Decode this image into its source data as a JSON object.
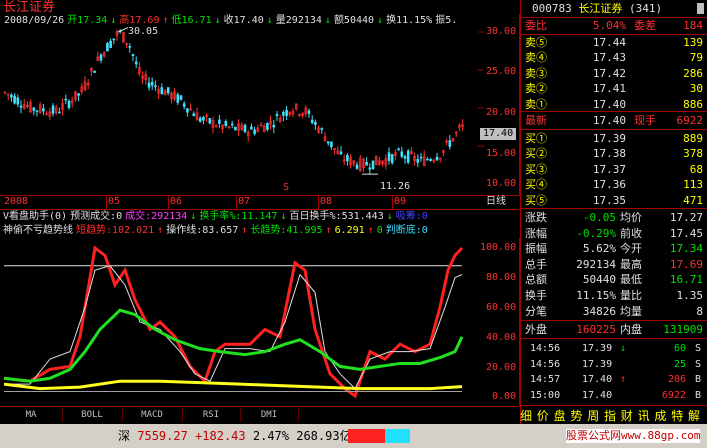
{
  "window": {
    "title": "长江证券",
    "menu_icon": "dropdown-arrow-icon"
  },
  "price_panel": {
    "info_line": [
      {
        "text": "2008/09/26",
        "color": "#e0e0e0"
      },
      {
        "text": "开17.34",
        "color": "#00e000"
      },
      {
        "text": "↓",
        "color": "#00e000"
      },
      {
        "text": "高17.69",
        "color": "#ff3030"
      },
      {
        "text": "↑",
        "color": "#ff3030"
      },
      {
        "text": "低16.71",
        "color": "#00e000"
      },
      {
        "text": "↓",
        "color": "#00e000"
      },
      {
        "text": "收17.40",
        "color": "#e0e0e0"
      },
      {
        "text": "↓",
        "color": "#00e000"
      },
      {
        "text": "量292134",
        "color": "#e0e0e0"
      },
      {
        "text": "↓",
        "color": "#00e000"
      },
      {
        "text": "额50440",
        "color": "#e0e0e0"
      },
      {
        "text": "↓",
        "color": "#00e000"
      },
      {
        "text": "换11.15%",
        "color": "#e0e0e0"
      },
      {
        "text": "振5.",
        "color": "#e0e0e0"
      }
    ],
    "y_axis": [
      "30.00",
      "25.00",
      "20.00",
      "15.00",
      "10.00"
    ],
    "high_label": "30.05",
    "low_label": "11.26",
    "current_price_marker": "17.40",
    "signal_mark": "S",
    "x_axis": [
      "2008",
      "05",
      "06",
      "07",
      "08",
      "09"
    ],
    "period_label": "日线"
  },
  "indicator_panel": {
    "line1": [
      {
        "text": "V看盘助手(0)",
        "color": "#e0e0e0"
      },
      {
        "text": "预测成交:0",
        "color": "#e0e0e0"
      },
      {
        "text": "成交:292134",
        "color": "#ff40ff"
      },
      {
        "text": "↓",
        "color": "#00e000"
      },
      {
        "text": "换手率%:11.147",
        "color": "#00e000"
      },
      {
        "text": "↓",
        "color": "#00e000"
      },
      {
        "text": "百日换手%:531.443",
        "color": "#e0e0e0"
      },
      {
        "text": "↓",
        "color": "#00e000"
      },
      {
        "text": "吸筹:0",
        "color": "#4040ff"
      }
    ],
    "line2": [
      {
        "text": "神偷不亏趋势线",
        "color": "#e0e0e0"
      },
      {
        "text": "短趋势:102.021",
        "color": "#ff3030"
      },
      {
        "text": "↑",
        "color": "#ff3030"
      },
      {
        "text": "操作线:83.657",
        "color": "#e0e0e0"
      },
      {
        "text": "↑",
        "color": "#ff3030"
      },
      {
        "text": "长趋势:41.995",
        "color": "#00e000"
      },
      {
        "text": "↑",
        "color": "#ff3030"
      },
      {
        "text": "6.291",
        "color": "#ffff00"
      },
      {
        "text": "↑",
        "color": "#ff3030"
      },
      {
        "text": "0",
        "color": "#00e000"
      },
      {
        "text": "判断底:0",
        "color": "#40e0ff"
      }
    ],
    "y_axis": [
      "100.00",
      "80.00",
      "60.00",
      "40.00",
      "20.00",
      "0.00"
    ],
    "tabs": [
      "MA",
      "BOLL",
      "MACD",
      "RSI",
      "DMI"
    ]
  },
  "quote": {
    "code": "000783",
    "name": "长江证券",
    "count": "(341)",
    "weibi_label": "委比",
    "weibi_value": "5.04%",
    "weicha_label": "委差",
    "weicha_value": "184",
    "asks": [
      {
        "label": "卖⑤",
        "price": "17.44",
        "vol": "139"
      },
      {
        "label": "卖④",
        "price": "17.43",
        "vol": "79"
      },
      {
        "label": "卖③",
        "price": "17.42",
        "vol": "286"
      },
      {
        "label": "卖②",
        "price": "17.41",
        "vol": "30"
      },
      {
        "label": "卖①",
        "price": "17.40",
        "vol": "886"
      }
    ],
    "latest_label": "最新",
    "latest_value": "17.40",
    "current_hand_label": "现手",
    "current_hand_value": "6922",
    "bids": [
      {
        "label": "买①",
        "price": "17.39",
        "vol": "889"
      },
      {
        "label": "买②",
        "price": "17.38",
        "vol": "378"
      },
      {
        "label": "买③",
        "price": "17.37",
        "vol": "68"
      },
      {
        "label": "买④",
        "price": "17.36",
        "vol": "113"
      },
      {
        "label": "买⑤",
        "price": "17.35",
        "vol": "471"
      }
    ],
    "stats": [
      {
        "l1": "涨跌",
        "v1": "-0.05",
        "c1": "#00e000",
        "l2": "均价",
        "v2": "17.27",
        "c2": "#e0e0e0"
      },
      {
        "l1": "涨幅",
        "v1": "-0.29%",
        "c1": "#00e000",
        "l2": "前收",
        "v2": "17.45",
        "c2": "#e0e0e0"
      },
      {
        "l1": "振幅",
        "v1": "5.62%",
        "c1": "#e0e0e0",
        "l2": "今开",
        "v2": "17.34",
        "c2": "#00e000"
      },
      {
        "l1": "总手",
        "v1": "292134",
        "c1": "#e0e0e0",
        "l2": "最高",
        "v2": "17.69",
        "c2": "#ff3030"
      },
      {
        "l1": "总额",
        "v1": "50440",
        "c1": "#e0e0e0",
        "l2": "最低",
        "v2": "16.71",
        "c2": "#00e000"
      },
      {
        "l1": "换手",
        "v1": "11.15%",
        "c1": "#e0e0e0",
        "l2": "量比",
        "v2": "1.35",
        "c2": "#e0e0e0"
      },
      {
        "l1": "分笔",
        "v1": "34826",
        "c1": "#e0e0e0",
        "l2": "均量",
        "v2": "8",
        "c2": "#e0e0e0"
      }
    ],
    "outer_label": "外盘",
    "outer_value": "160225",
    "inner_label": "内盘",
    "inner_value": "131909",
    "ticks": [
      {
        "time": "14:56",
        "price": "17.39",
        "arrow": "↓",
        "arrow_color": "#00e000",
        "vol": "60",
        "side": "S"
      },
      {
        "time": "14:56",
        "price": "17.39",
        "arrow": "",
        "arrow_color": "#00e000",
        "vol": "25",
        "side": "S"
      },
      {
        "time": "14:57",
        "price": "17.40",
        "arrow": "↑",
        "arrow_color": "#ff3030",
        "vol": "206",
        "side": "B"
      },
      {
        "time": "15:00",
        "price": "17.40",
        "arrow": "",
        "arrow_color": "#ff3030",
        "vol": "6922",
        "side": "B"
      }
    ],
    "bottom_tabs": [
      "细",
      "价",
      "盘",
      "势",
      "周",
      "指",
      "财",
      "讯",
      "成",
      "特",
      "解"
    ]
  },
  "status_bar": {
    "market": "深",
    "index": "7559.27",
    "change": "+182.43",
    "pct": "2.47%",
    "amount": "268.93亿",
    "watermark": "股票公式网www.88gp.com"
  }
}
